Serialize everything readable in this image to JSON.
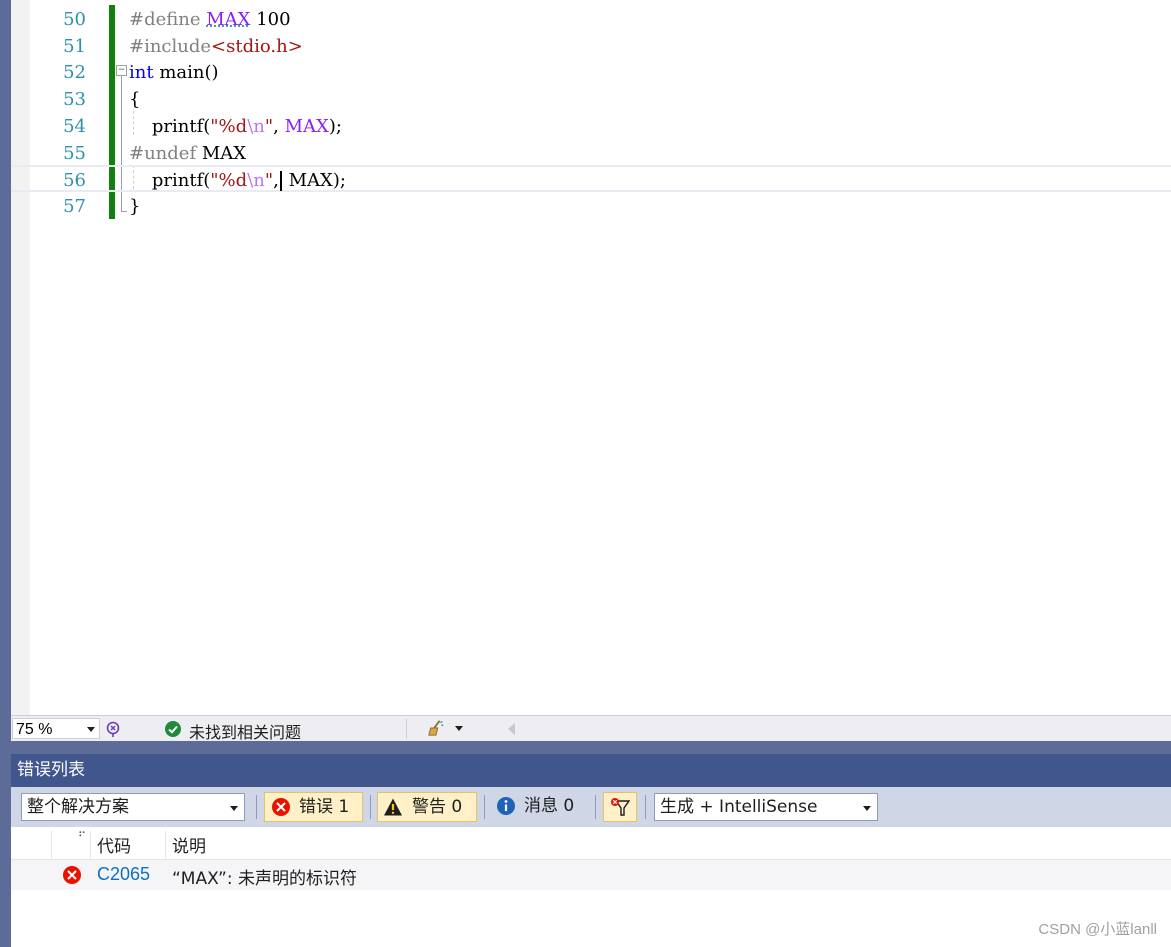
{
  "editor": {
    "lines": [
      {
        "num": "50",
        "parts": [
          {
            "t": "#define ",
            "c": "pp"
          },
          {
            "t": "MAX",
            "c": "mac"
          },
          {
            "t": " 100",
            "c": "num"
          }
        ]
      },
      {
        "num": "51",
        "parts": [
          {
            "t": "#include",
            "c": "pp"
          },
          {
            "t": "<stdio.h>",
            "c": "str"
          }
        ]
      },
      {
        "num": "52",
        "parts": [
          {
            "t": "int",
            "c": "kw"
          },
          {
            "t": " main()",
            "c": "num"
          }
        ]
      },
      {
        "num": "53",
        "parts": [
          {
            "t": "{",
            "c": "num"
          }
        ]
      },
      {
        "num": "54",
        "parts": [
          {
            "t": "    printf(",
            "c": "num"
          },
          {
            "t": "\"%d",
            "c": "str"
          },
          {
            "t": "\\n",
            "c": "esc"
          },
          {
            "t": "\"",
            "c": "str"
          },
          {
            "t": ", ",
            "c": "num"
          },
          {
            "t": "MAX",
            "c": "mac"
          },
          {
            "t": ");",
            "c": "num"
          }
        ]
      },
      {
        "num": "55",
        "parts": [
          {
            "t": "#undef ",
            "c": "pp"
          },
          {
            "t": "MAX",
            "c": "num"
          }
        ]
      },
      {
        "num": "56",
        "parts": [
          {
            "t": "    printf(",
            "c": "num"
          },
          {
            "t": "\"%d",
            "c": "str"
          },
          {
            "t": "\\n",
            "c": "esc"
          },
          {
            "t": "\"",
            "c": "str"
          },
          {
            "t": ",",
            "c": "num"
          },
          {
            "t": "|",
            "c": "caret"
          },
          {
            "t": " MAX);",
            "c": "num"
          }
        ]
      },
      {
        "num": "57",
        "parts": [
          {
            "t": "}",
            "c": "num"
          }
        ]
      }
    ]
  },
  "status": {
    "zoom": "75 %",
    "issues_text": "未找到相关问题"
  },
  "error_list": {
    "title": "错误列表",
    "scope": "整个解决方案",
    "errors_label": "错误 1",
    "warnings_label": "警告 0",
    "messages_label": "消息 0",
    "source": "生成 + IntelliSense",
    "col_code": "代码",
    "col_desc": "说明",
    "rows": [
      {
        "code": "C2065",
        "desc": "“MAX”: 未声明的标识符"
      }
    ]
  },
  "watermark": "CSDN @小蓝lanll",
  "colors": {
    "keyword": "#0000ff",
    "macro": "#8a1bff",
    "string": "#a31515",
    "line_number": "#2b91af",
    "change_bar": "#108010",
    "panel_title": "#40568d",
    "error_icon": "#e51400"
  }
}
